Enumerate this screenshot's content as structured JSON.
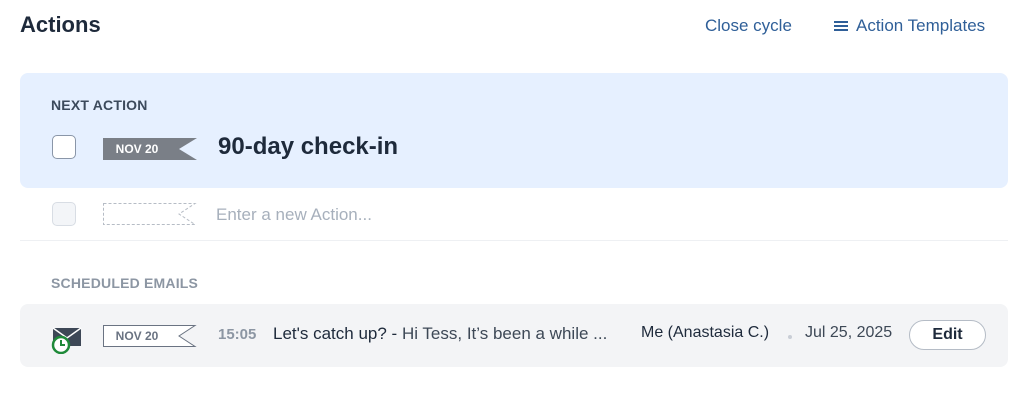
{
  "header": {
    "title": "Actions",
    "close_cycle_label": "Close cycle",
    "templates_label": "Action Templates"
  },
  "next_action": {
    "section_label": "NEXT ACTION",
    "date_tag": "NOV 20",
    "title": "90-day check-in",
    "checked": false
  },
  "new_action": {
    "placeholder": "Enter a new Action..."
  },
  "scheduled_emails": {
    "section_label": "SCHEDULED EMAILS",
    "items": [
      {
        "date_tag": "NOV 20",
        "time": "15:05",
        "subject": "Let's catch up? -",
        "preview": "Hi Tess, It’s been a while ...",
        "sender": "Me (Anastasia C.)",
        "date": "Jul 25, 2025",
        "edit_label": "Edit"
      }
    ]
  },
  "colors": {
    "accent": "#2f5f98",
    "next_card_bg": "#e6f0ff",
    "date_flag": "#7a7f87",
    "clock_green": "#1f8a3a"
  },
  "icons": {
    "templates": "list-icon",
    "email": "scheduled-email-icon"
  }
}
